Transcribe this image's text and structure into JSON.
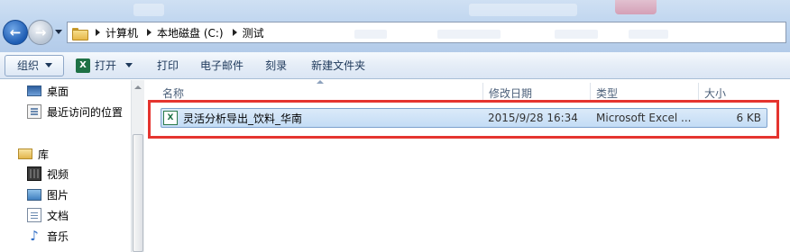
{
  "address": {
    "crumbs": [
      "计算机",
      "本地磁盘 (C:)",
      "测试"
    ]
  },
  "toolbar": {
    "organize": "组织",
    "open": "打开",
    "print": "打印",
    "email": "电子邮件",
    "burn": "刻录",
    "new_folder": "新建文件夹",
    "open_icon": "excel-icon"
  },
  "navpane": {
    "items": [
      {
        "label": "桌面",
        "icon": "desktop-icon"
      },
      {
        "label": "最近访问的位置",
        "icon": "recent-places-icon"
      },
      {
        "label": "库",
        "icon": "library-icon"
      },
      {
        "label": "视频",
        "icon": "video-icon"
      },
      {
        "label": "图片",
        "icon": "picture-icon"
      },
      {
        "label": "文档",
        "icon": "document-icon"
      },
      {
        "label": "音乐",
        "icon": "music-icon"
      }
    ]
  },
  "filelist": {
    "columns": {
      "name": "名称",
      "modified": "修改日期",
      "type": "类型",
      "size": "大小"
    },
    "files": [
      {
        "name": "灵活分析导出_饮料_华南",
        "modified": "2015/9/28 16:34",
        "type": "Microsoft Excel ...",
        "size": "6 KB",
        "icon": "excel-file-icon"
      }
    ]
  },
  "colors": {
    "highlight": "#e5342f",
    "selection": "#c3dcf5",
    "title_bg": "#bcd3ee"
  }
}
